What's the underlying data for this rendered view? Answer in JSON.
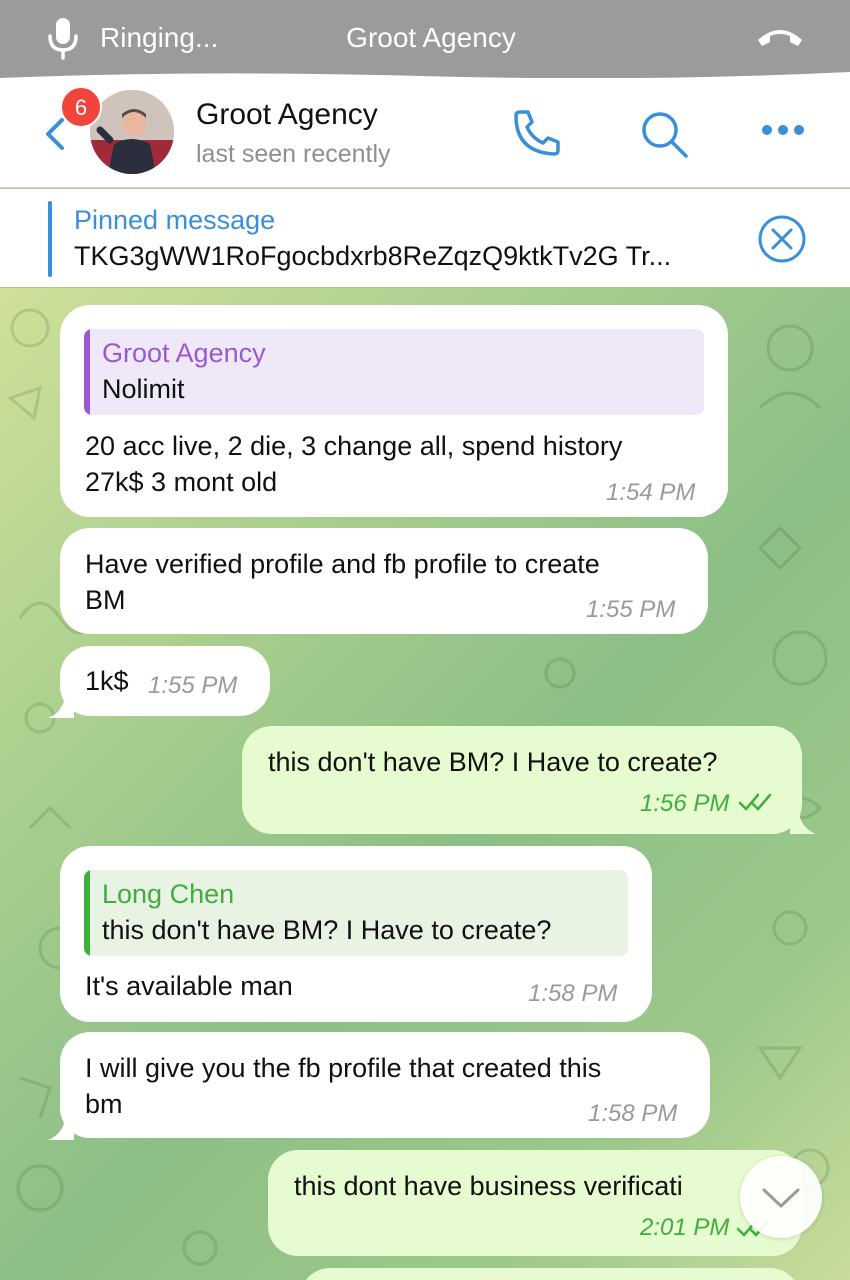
{
  "call_bar": {
    "status": "Ringing...",
    "title": "Groot Agency"
  },
  "header": {
    "unread_count": "6",
    "name": "Groot Agency",
    "status": "last seen recently"
  },
  "pinned": {
    "label": "Pinned message",
    "text": "TKG3gWW1RoFgocbdxrb8ReZqzQ9ktkTv2G Tr..."
  },
  "messages": [
    {
      "direction": "in",
      "reply": {
        "name": "Groot Agency",
        "text": "Nolimit"
      },
      "lines": [
        "20 acc live, 2 die, 3 change all, spend history",
        "27k$ 3 mont old"
      ],
      "time": "1:54 PM"
    },
    {
      "direction": "in",
      "lines": [
        "Have verified profile and fb profile to create",
        "BM"
      ],
      "time": "1:55 PM"
    },
    {
      "direction": "in",
      "lines": [
        "1k$"
      ],
      "time": "1:55 PM"
    },
    {
      "direction": "out",
      "lines": [
        "this don't have BM? I Have to create?"
      ],
      "time": "1:56 PM",
      "read": true
    },
    {
      "direction": "in",
      "reply": {
        "name": "Long Chen",
        "text": "this don't have BM? I Have to create?"
      },
      "lines": [
        "It's available man"
      ],
      "time": "1:58 PM"
    },
    {
      "direction": "in",
      "lines": [
        "I will give you the fb profile that created this",
        "bm"
      ],
      "time": "1:58 PM"
    },
    {
      "direction": "out",
      "lines": [
        "this dont have business verificati"
      ],
      "time": "2:01 PM",
      "read": true
    }
  ],
  "colors": {
    "accent": "#3a8fd9",
    "badge": "#f0453a",
    "outgoing_bubble": "#e6fbcf",
    "reply_purple": "#9b59d0",
    "reply_green": "#3fae3f"
  },
  "icons": [
    "microphone-icon",
    "hang-up-icon",
    "back-icon",
    "phone-icon",
    "search-icon",
    "more-icon",
    "close-icon",
    "read-checkmarks-icon",
    "chevron-down-icon"
  ]
}
